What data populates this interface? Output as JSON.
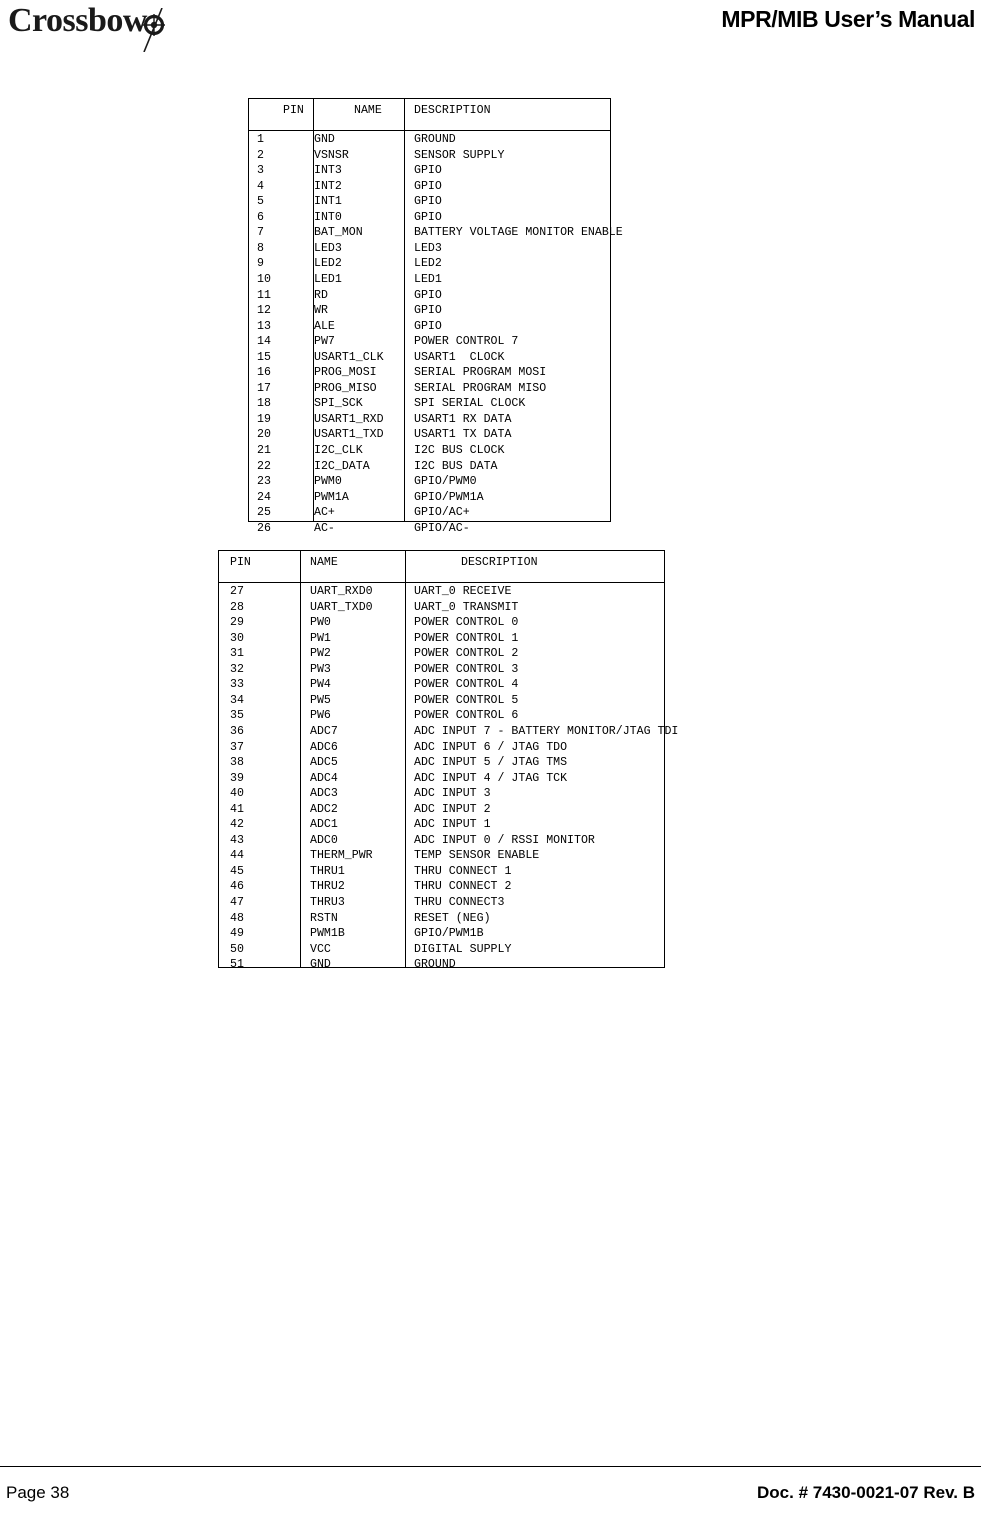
{
  "header": {
    "logo_text": "Crossbow",
    "logo_icon": "crosshair-arrow-icon",
    "title": "MPR/MIB User’s Manual"
  },
  "footer": {
    "page_label": "Page 38",
    "doc_label": "Doc. # 7430-0021-07 Rev. B"
  },
  "table1": {
    "columns": [
      "PIN",
      "NAME",
      "DESCRIPTION"
    ],
    "rows": [
      [
        "1",
        "GND",
        "GROUND"
      ],
      [
        "2",
        "VSNSR",
        "SENSOR SUPPLY"
      ],
      [
        "3",
        "INT3",
        "GPIO"
      ],
      [
        "4",
        "INT2",
        "GPIO"
      ],
      [
        "5",
        "INT1",
        "GPIO"
      ],
      [
        "6",
        "INT0",
        "GPIO"
      ],
      [
        "7",
        "BAT_MON",
        "BATTERY VOLTAGE MONITOR ENABLE"
      ],
      [
        "8",
        "LED3",
        "LED3"
      ],
      [
        "9",
        "LED2",
        "LED2"
      ],
      [
        "10",
        "LED1",
        "LED1"
      ],
      [
        "11",
        "RD",
        "GPIO"
      ],
      [
        "12",
        "WR",
        "GPIO"
      ],
      [
        "13",
        "ALE",
        "GPIO"
      ],
      [
        "14",
        "PW7",
        "POWER CONTROL 7"
      ],
      [
        "15",
        "USART1_CLK",
        "USART1  CLOCK"
      ],
      [
        "16",
        "PROG_MOSI",
        "SERIAL PROGRAM MOSI"
      ],
      [
        "17",
        "PROG_MISO",
        "SERIAL PROGRAM MISO"
      ],
      [
        "18",
        "SPI_SCK",
        "SPI SERIAL CLOCK"
      ],
      [
        "19",
        "USART1_RXD",
        "USART1 RX DATA"
      ],
      [
        "20",
        "USART1_TXD",
        "USART1 TX DATA"
      ],
      [
        "21",
        "I2C_CLK",
        "I2C BUS CLOCK"
      ],
      [
        "22",
        "I2C_DATA",
        "I2C BUS DATA"
      ],
      [
        "23",
        "PWM0",
        "GPIO/PWM0"
      ],
      [
        "24",
        "PWM1A",
        "GPIO/PWM1A"
      ],
      [
        "25",
        "AC+",
        "GPIO/AC+"
      ],
      [
        "26",
        "AC-",
        "GPIO/AC-"
      ]
    ]
  },
  "table2": {
    "columns": [
      "PIN",
      "NAME",
      "DESCRIPTION"
    ],
    "rows": [
      [
        "27",
        "UART_RXD0",
        "UART_0 RECEIVE"
      ],
      [
        "28",
        "UART_TXD0",
        "UART_0 TRANSMIT"
      ],
      [
        "29",
        "PW0",
        "POWER CONTROL 0"
      ],
      [
        "30",
        "PW1",
        "POWER CONTROL 1"
      ],
      [
        "31",
        "PW2",
        "POWER CONTROL 2"
      ],
      [
        "32",
        "PW3",
        "POWER CONTROL 3"
      ],
      [
        "33",
        "PW4",
        "POWER CONTROL 4"
      ],
      [
        "34",
        "PW5",
        "POWER CONTROL 5"
      ],
      [
        "35",
        "PW6",
        "POWER CONTROL 6"
      ],
      [
        "36",
        "ADC7",
        "ADC INPUT 7 - BATTERY MONITOR/JTAG TDI"
      ],
      [
        "37",
        "ADC6",
        "ADC INPUT 6 / JTAG TDO"
      ],
      [
        "38",
        "ADC5",
        "ADC INPUT 5 / JTAG TMS"
      ],
      [
        "39",
        "ADC4",
        "ADC INPUT 4 / JTAG TCK"
      ],
      [
        "40",
        "ADC3",
        "ADC INPUT 3"
      ],
      [
        "41",
        "ADC2",
        "ADC INPUT 2"
      ],
      [
        "42",
        "ADC1",
        "ADC INPUT 1"
      ],
      [
        "43",
        "ADC0",
        "ADC INPUT 0 / RSSI MONITOR"
      ],
      [
        "44",
        "THERM_PWR",
        "TEMP SENSOR ENABLE"
      ],
      [
        "45",
        "THRU1",
        "THRU CONNECT 1"
      ],
      [
        "46",
        "THRU2",
        "THRU CONNECT 2"
      ],
      [
        "47",
        "THRU3",
        "THRU CONNECT3"
      ],
      [
        "48",
        "RSTN",
        "RESET (NEG)"
      ],
      [
        "49",
        "PWM1B",
        "GPIO/PWM1B"
      ],
      [
        "50",
        "VCC",
        "DIGITAL SUPPLY"
      ],
      [
        "51",
        "GND",
        "GROUND"
      ]
    ]
  }
}
